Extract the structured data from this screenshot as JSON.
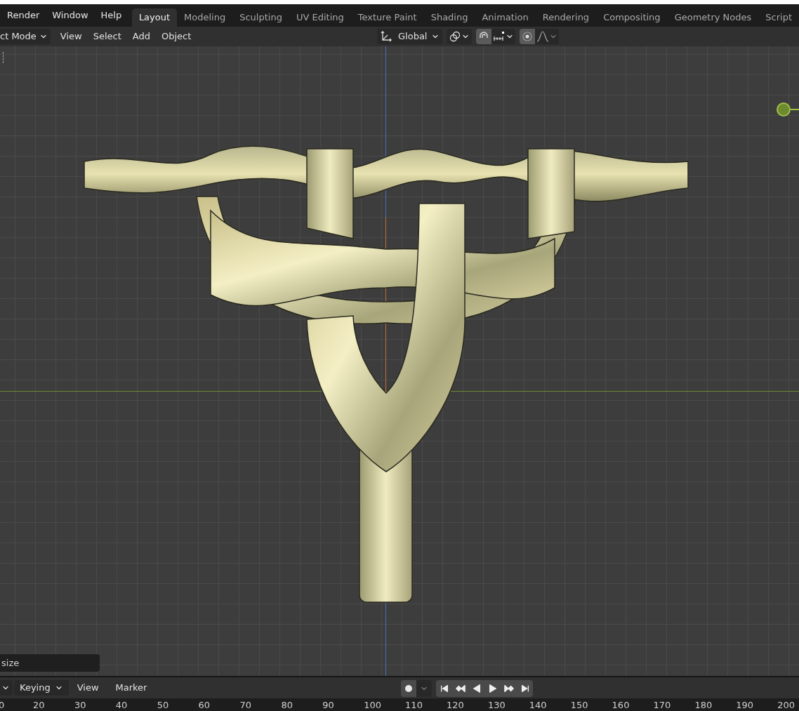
{
  "top_bar": {
    "menus": [
      "Render",
      "Window",
      "Help"
    ],
    "workspace_tabs": [
      {
        "label": "Layout",
        "selected": true
      },
      {
        "label": "Modeling",
        "selected": false
      },
      {
        "label": "Sculpting",
        "selected": false
      },
      {
        "label": "UV Editing",
        "selected": false
      },
      {
        "label": "Texture Paint",
        "selected": false
      },
      {
        "label": "Shading",
        "selected": false
      },
      {
        "label": "Animation",
        "selected": false
      },
      {
        "label": "Rendering",
        "selected": false
      },
      {
        "label": "Compositing",
        "selected": false
      },
      {
        "label": "Geometry Nodes",
        "selected": false
      },
      {
        "label": "Script",
        "selected": false
      }
    ]
  },
  "viewport_header": {
    "mode_dropdown": "ct Mode",
    "menus": [
      "View",
      "Select",
      "Add",
      "Object"
    ],
    "orientation": "Global",
    "snap_on": true,
    "proportional_editing_on": true
  },
  "viewport": {
    "operator_field": "size"
  },
  "timeline": {
    "menus": [
      {
        "label": "Keying",
        "kind": "dropdown"
      },
      {
        "label": "View",
        "kind": "menu"
      },
      {
        "label": "Marker",
        "kind": "menu"
      }
    ],
    "frame_ruler": [
      "0",
      "20",
      "30",
      "40",
      "50",
      "60",
      "70",
      "80",
      "90",
      "100",
      "110",
      "120",
      "130",
      "140",
      "150",
      "160",
      "170",
      "180",
      "190",
      "200"
    ]
  }
}
